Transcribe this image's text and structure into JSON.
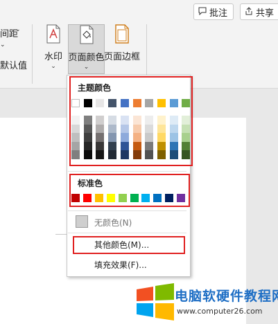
{
  "toolbar": {
    "comment_label": "批注",
    "share_label": "共享",
    "spacing_label": "间距",
    "default_label": "默认值",
    "watermark_label": "水印",
    "page_color_label": "页面颜色",
    "page_border_label": "页面边框"
  },
  "dropdown": {
    "theme_colors_title": "主题颜色",
    "standard_colors_title": "标准色",
    "no_color_label": "无颜色(N)",
    "more_colors_label": "其他颜色(M)...",
    "fill_effects_label": "填充效果(F)..."
  },
  "theme_colors": {
    "row0": [
      "#ffffff",
      "#000000",
      "#e7e6e6",
      "#44546a",
      "#4472c4",
      "#ed7d31",
      "#a5a5a5",
      "#ffc000",
      "#5b9bd5",
      "#70ad47"
    ],
    "shades": [
      [
        "#f2f2f2",
        "#7f7f7f",
        "#d0cece",
        "#d6dce4",
        "#d9e2f3",
        "#fbe5d5",
        "#ededed",
        "#fff2cc",
        "#deebf6",
        "#e2efd9"
      ],
      [
        "#d8d8d8",
        "#595959",
        "#aeabab",
        "#adb9ca",
        "#b4c6e7",
        "#f7cbac",
        "#dbdbdb",
        "#fee599",
        "#bdd7ee",
        "#c5e0b3"
      ],
      [
        "#bfbfbf",
        "#3f3f3f",
        "#757070",
        "#8496b0",
        "#8eaadb",
        "#f4b183",
        "#c9c9c9",
        "#ffd965",
        "#9cc3e5",
        "#a8d08d"
      ],
      [
        "#a5a5a5",
        "#262626",
        "#3a3838",
        "#323f4f",
        "#2f5496",
        "#c55a11",
        "#7b7b7b",
        "#bf9000",
        "#2e75b5",
        "#538135"
      ],
      [
        "#7f7f7f",
        "#0c0c0c",
        "#171616",
        "#222a35",
        "#1f3864",
        "#833c0b",
        "#525252",
        "#7f6000",
        "#1e4e79",
        "#375623"
      ]
    ]
  },
  "standard_colors": [
    "#c00000",
    "#ff0000",
    "#ffc000",
    "#ffff00",
    "#92d050",
    "#00b050",
    "#00b0f0",
    "#0070c0",
    "#002060",
    "#7030a0"
  ],
  "logo": {
    "title": "电脑软硬件教程网",
    "url": "www.computer26.com",
    "colors": [
      "#f25022",
      "#7fba00",
      "#00a4ef",
      "#ffb900"
    ]
  }
}
